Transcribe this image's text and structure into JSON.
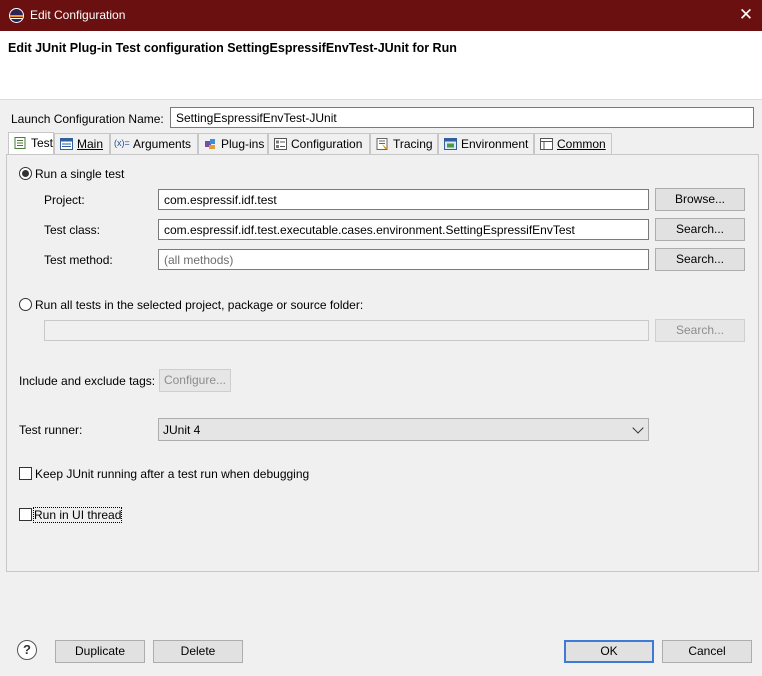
{
  "window": {
    "title": "Edit Configuration",
    "close_glyph": "✕"
  },
  "banner": {
    "heading": "Edit JUnit Plug-in Test configuration SettingEspressifEnvTest-JUnit for Run"
  },
  "launch": {
    "label": "Launch Configuration Name:",
    "value": "SettingEspressifEnvTest-JUnit"
  },
  "tabs": [
    {
      "label": "Test",
      "icon": "test-tab-icon",
      "active": true
    },
    {
      "label": "Main",
      "icon": "main-tab-icon"
    },
    {
      "label": "Arguments",
      "icon": "arguments-tab-icon",
      "icon_text": "(x)="
    },
    {
      "label": "Plug-ins",
      "icon": "plugins-tab-icon"
    },
    {
      "label": "Configuration",
      "icon": "configuration-tab-icon"
    },
    {
      "label": "Tracing",
      "icon": "tracing-tab-icon"
    },
    {
      "label": "Environment",
      "icon": "environment-tab-icon"
    },
    {
      "label": "Common",
      "icon": "common-tab-icon"
    }
  ],
  "single_test": {
    "radio_label": "Run a single test",
    "checked": true,
    "project_label": "Project:",
    "project_value": "com.espressif.idf.test",
    "browse_label": "Browse...",
    "class_label": "Test class:",
    "class_value": "com.espressif.idf.test.executable.cases.environment.SettingEspressifEnvTest",
    "class_search_label": "Search...",
    "method_label": "Test method:",
    "method_placeholder": "(all methods)",
    "method_search_label": "Search..."
  },
  "all_tests": {
    "radio_label": "Run all tests in the selected project, package or source folder:",
    "checked": false,
    "value": "",
    "search_label": "Search..."
  },
  "tags": {
    "label": "Include and exclude tags:",
    "configure_label": "Configure..."
  },
  "runner": {
    "label": "Test runner:",
    "value": "JUnit 4"
  },
  "options": {
    "keep_running_label": "Keep JUnit running after a test run when debugging",
    "keep_running_checked": false,
    "ui_thread_label": "Run in UI thread",
    "ui_thread_checked": false
  },
  "footer": {
    "help_glyph": "?",
    "duplicate_label": "Duplicate",
    "delete_label": "Delete",
    "ok_label": "OK",
    "cancel_label": "Cancel"
  },
  "colors": {
    "titlebar": "#6b1010",
    "accent_border": "#3d7bd6"
  }
}
